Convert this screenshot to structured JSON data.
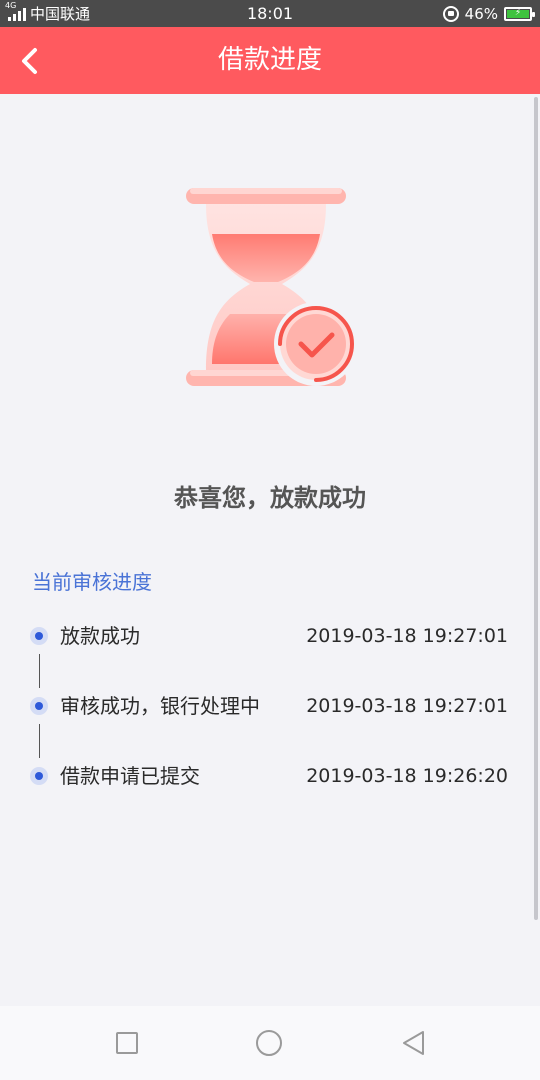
{
  "status_bar": {
    "network_type": "4G",
    "carrier": "中国联通",
    "time": "18:01",
    "battery_percent": "46%",
    "battery_level": 0.46,
    "battery_color": "#3ec33e"
  },
  "header": {
    "title": "借款进度",
    "background_color": "#ff5a5f",
    "back_icon": "chevron-left-icon"
  },
  "illustration": {
    "icon": "hourglass-checkmark-icon"
  },
  "main": {
    "success_message": "恭喜您，放款成功",
    "section_title": "当前审核进度",
    "accent_color": "#4a73d6",
    "timeline": [
      {
        "label": "放款成功",
        "time": "2019-03-18 19:27:01"
      },
      {
        "label": "审核成功，银行处理中",
        "time": "2019-03-18 19:27:01"
      },
      {
        "label": "借款申请已提交",
        "time": "2019-03-18 19:26:20"
      }
    ]
  },
  "nav_bar": {
    "recent_icon": "square-icon",
    "home_icon": "circle-icon",
    "back_icon": "triangle-back-icon"
  }
}
